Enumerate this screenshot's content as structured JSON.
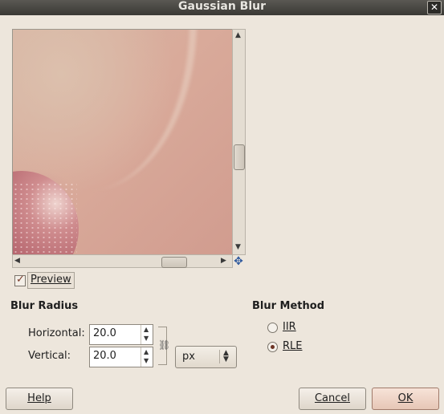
{
  "window": {
    "title": "Gaussian Blur",
    "close_glyph": "✕"
  },
  "preview": {
    "label": "Preview",
    "checked": true,
    "image_desc_icon": "navigate-icon"
  },
  "scrollbars": {
    "up_glyph": "▲",
    "down_glyph": "▼",
    "left_glyph": "◀",
    "right_glyph": "▶",
    "navigate_glyph": "✥"
  },
  "blur_radius": {
    "title": "Blur Radius",
    "horizontal_label": "Horizontal:",
    "horizontal_value": "20.0",
    "vertical_label": "Vertical:",
    "vertical_value": "20.0",
    "unit": "px",
    "spin_up": "▲",
    "spin_down": "▼",
    "chain_glyph": "⛓"
  },
  "blur_method": {
    "title": "Blur Method",
    "options": [
      {
        "label": "IIR",
        "selected": false
      },
      {
        "label": "RLE",
        "selected": true
      }
    ]
  },
  "buttons": {
    "help": "Help",
    "cancel": "Cancel",
    "ok": "OK"
  },
  "colors": {
    "titlebar": "#3a3935",
    "background": "#ede6dc",
    "navigate_icon": "#2f5a9e"
  }
}
